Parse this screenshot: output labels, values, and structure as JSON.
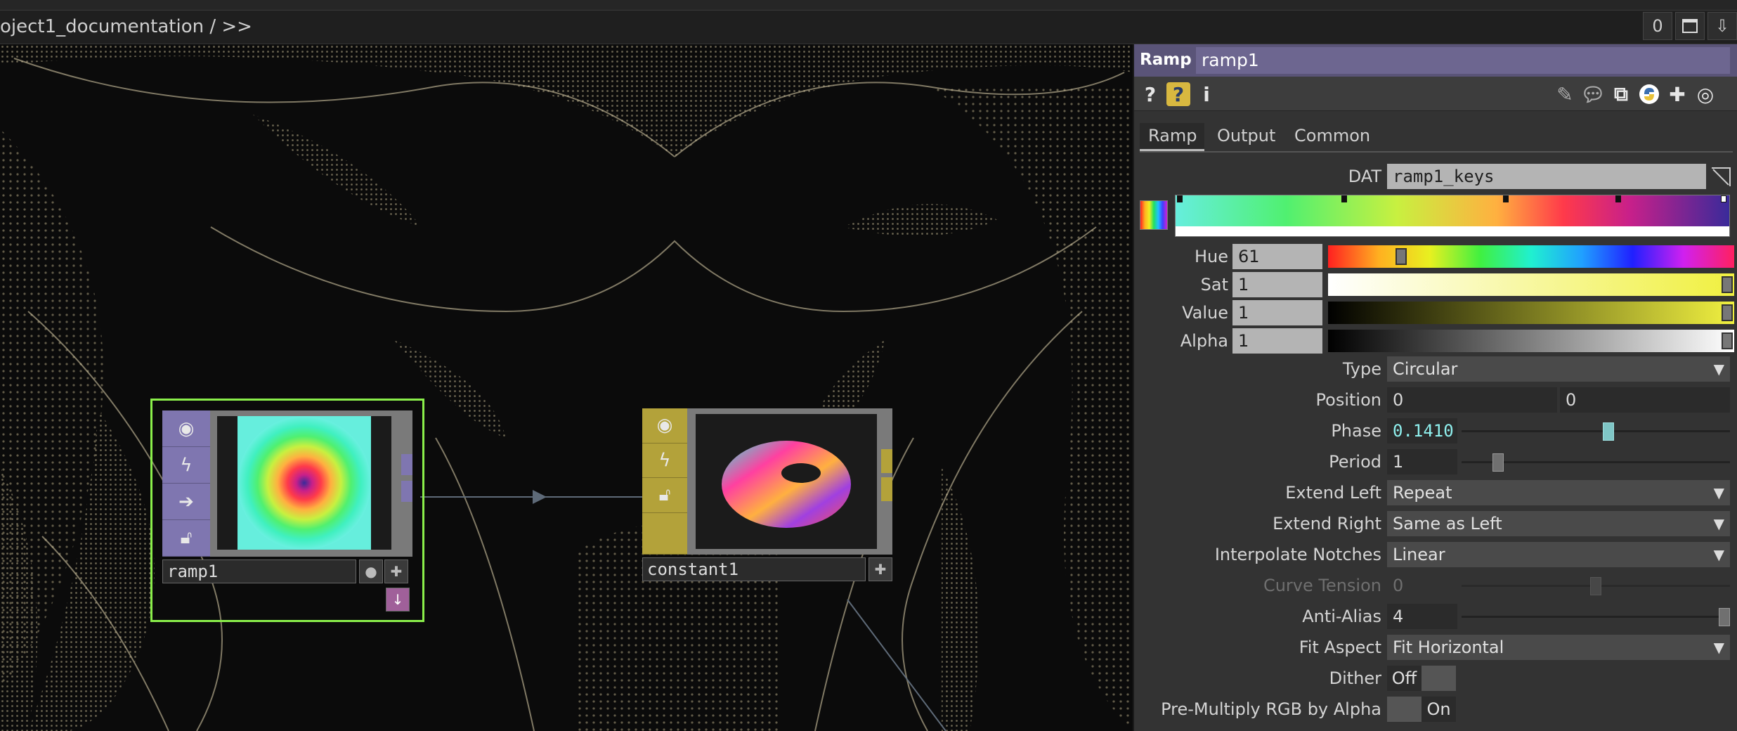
{
  "colors": {
    "ramp_node_accent": "#7f76b0",
    "constant_node_accent": "#b3a23a",
    "selection": "#8aef4a",
    "panel_header": "#5a5478",
    "pattern": "#c4b896"
  },
  "pathbar": {
    "path": "oject1_documentation / >>",
    "count": "0"
  },
  "nodes": {
    "ramp": {
      "name": "ramp1"
    },
    "constant": {
      "name": "constant1"
    }
  },
  "panel": {
    "op_type": "Ramp",
    "op_name": "ramp1",
    "toolbar_icons": [
      "help-icon",
      "python-help-icon",
      "info-icon",
      "edit-icon",
      "comment-icon",
      "clone-icon",
      "python-icon",
      "add-icon",
      "viewer-icon"
    ],
    "tabs": [
      "Ramp",
      "Output",
      "Common"
    ],
    "dat": {
      "label": "DAT",
      "value": "ramp1_keys"
    },
    "hsva": {
      "hue": {
        "label": "Hue",
        "value": "61",
        "level": 0.17
      },
      "sat": {
        "label": "Sat",
        "value": "1",
        "level": 1.0
      },
      "val": {
        "label": "Value",
        "value": "1",
        "level": 1.0
      },
      "alpha": {
        "label": "Alpha",
        "value": "1",
        "level": 1.0
      }
    },
    "params": {
      "type": {
        "label": "Type",
        "value": "Circular"
      },
      "position": {
        "label": "Position",
        "x": "0",
        "y": "0"
      },
      "phase": {
        "label": "Phase",
        "value": "0.1410",
        "level": 0.55
      },
      "period": {
        "label": "Period",
        "value": "1",
        "level": 0.12
      },
      "extend_left": {
        "label": "Extend Left",
        "value": "Repeat"
      },
      "extend_right": {
        "label": "Extend Right",
        "value": "Same as Left"
      },
      "interp": {
        "label": "Interpolate Notches",
        "value": "Linear"
      },
      "tension": {
        "label": "Curve Tension",
        "value": "0",
        "level": 0.5
      },
      "antialias": {
        "label": "Anti-Alias",
        "value": "4",
        "level": 1.0
      },
      "fit": {
        "label": "Fit Aspect",
        "value": "Fit Horizontal"
      },
      "dither": {
        "label": "Dither",
        "value": "Off"
      },
      "premult": {
        "label": "Pre-Multiply RGB by Alpha",
        "value": "On"
      }
    }
  }
}
